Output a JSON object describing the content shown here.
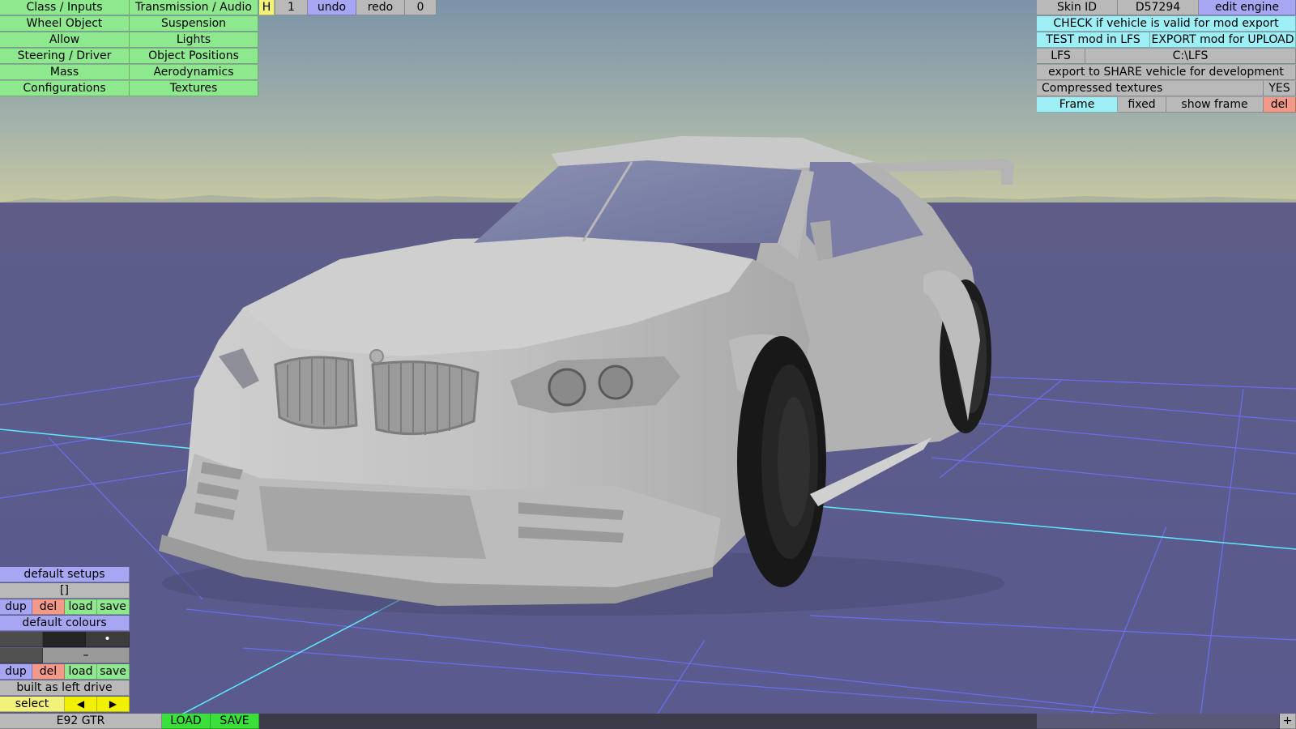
{
  "left_menu": {
    "col1": [
      "Class / Inputs",
      "Wheel Object",
      "Allow",
      "Steering / Driver",
      "Mass",
      "Configurations"
    ],
    "col2": [
      "Transmission / Audio",
      "Suspension",
      "Lights",
      "Object Positions",
      "Aerodynamics",
      "Textures"
    ]
  },
  "toolbar": {
    "h": "H",
    "count": "1",
    "undo": "undo",
    "redo": "redo",
    "redo_count": "0"
  },
  "right_panel": {
    "skin_id_label": "Skin ID",
    "skin_id_value": "D57294",
    "edit_engine": "edit engine",
    "check_valid": "CHECK if vehicle is valid for mod export",
    "test_mod": "TEST mod in LFS",
    "export_mod": "EXPORT mod for UPLOAD",
    "lfs_label": "LFS",
    "lfs_path": "C:\\LFS",
    "export_share": "export to SHARE vehicle for development",
    "compressed_textures": "Compressed textures",
    "compressed_value": "YES",
    "frame": "Frame",
    "fixed": "fixed",
    "show_frame": "show frame",
    "del": "del"
  },
  "bottom_left": {
    "default_setups": "default setups",
    "setup_value": "[]",
    "dup": "dup",
    "del": "del",
    "load": "load",
    "save": "save",
    "default_colours": "default colours",
    "colour_dot": "•",
    "colour_dash": "–",
    "built_as": "built as left drive",
    "select": "select",
    "prev": "◀",
    "next": "▶"
  },
  "status_bar": {
    "vehicle_name": "E92 GTR",
    "load": "LOAD",
    "save": "SAVE",
    "plus": "+"
  },
  "colors": {
    "menu_green": "#8ee88e",
    "button_blue": "#a6a6f2",
    "button_cyan": "#9eeef6",
    "button_red": "#f29a8a",
    "button_gray": "#b9b9b9",
    "floor": "#5a5a8c",
    "sky_top": "#7f97aa",
    "sky_bottom": "#b8c2a8",
    "car_body": "#c4c4c4",
    "grid_line": "#6f6fff"
  }
}
